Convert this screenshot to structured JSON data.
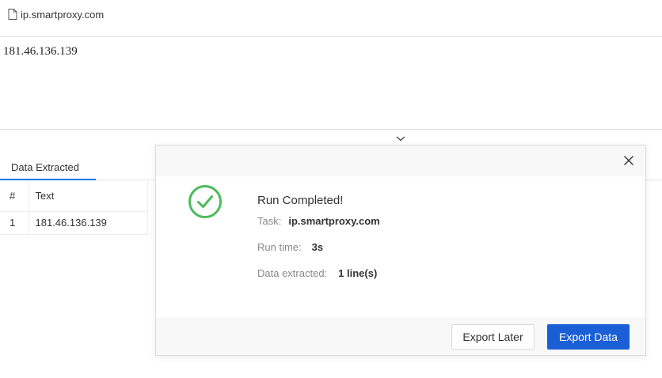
{
  "url_bar": {
    "url": "ip.smartproxy.com",
    "icon": "document-icon"
  },
  "page": {
    "content_text": "181.46.136.139"
  },
  "panel": {
    "tabs": [
      {
        "label": "Data Extracted",
        "active": true
      }
    ],
    "table": {
      "columns": [
        "#",
        "Text"
      ],
      "rows": [
        {
          "num": "1",
          "text": "181.46.136.139"
        }
      ]
    }
  },
  "modal": {
    "title": "Run Completed!",
    "task_label": "Task:",
    "task_value": "ip.smartproxy.com",
    "runtime_label": "Run time:",
    "runtime_value": "3s",
    "extracted_label": "Data extracted:",
    "extracted_value": "1 line(s)",
    "export_later_label": "Export Later",
    "export_data_label": "Export Data",
    "icons": {
      "status": "check-circle-icon",
      "close": "close-icon"
    }
  },
  "colors": {
    "accent": "#1a5fd6",
    "success": "#4cbb5a",
    "tab_underline": "#1a73e8"
  }
}
